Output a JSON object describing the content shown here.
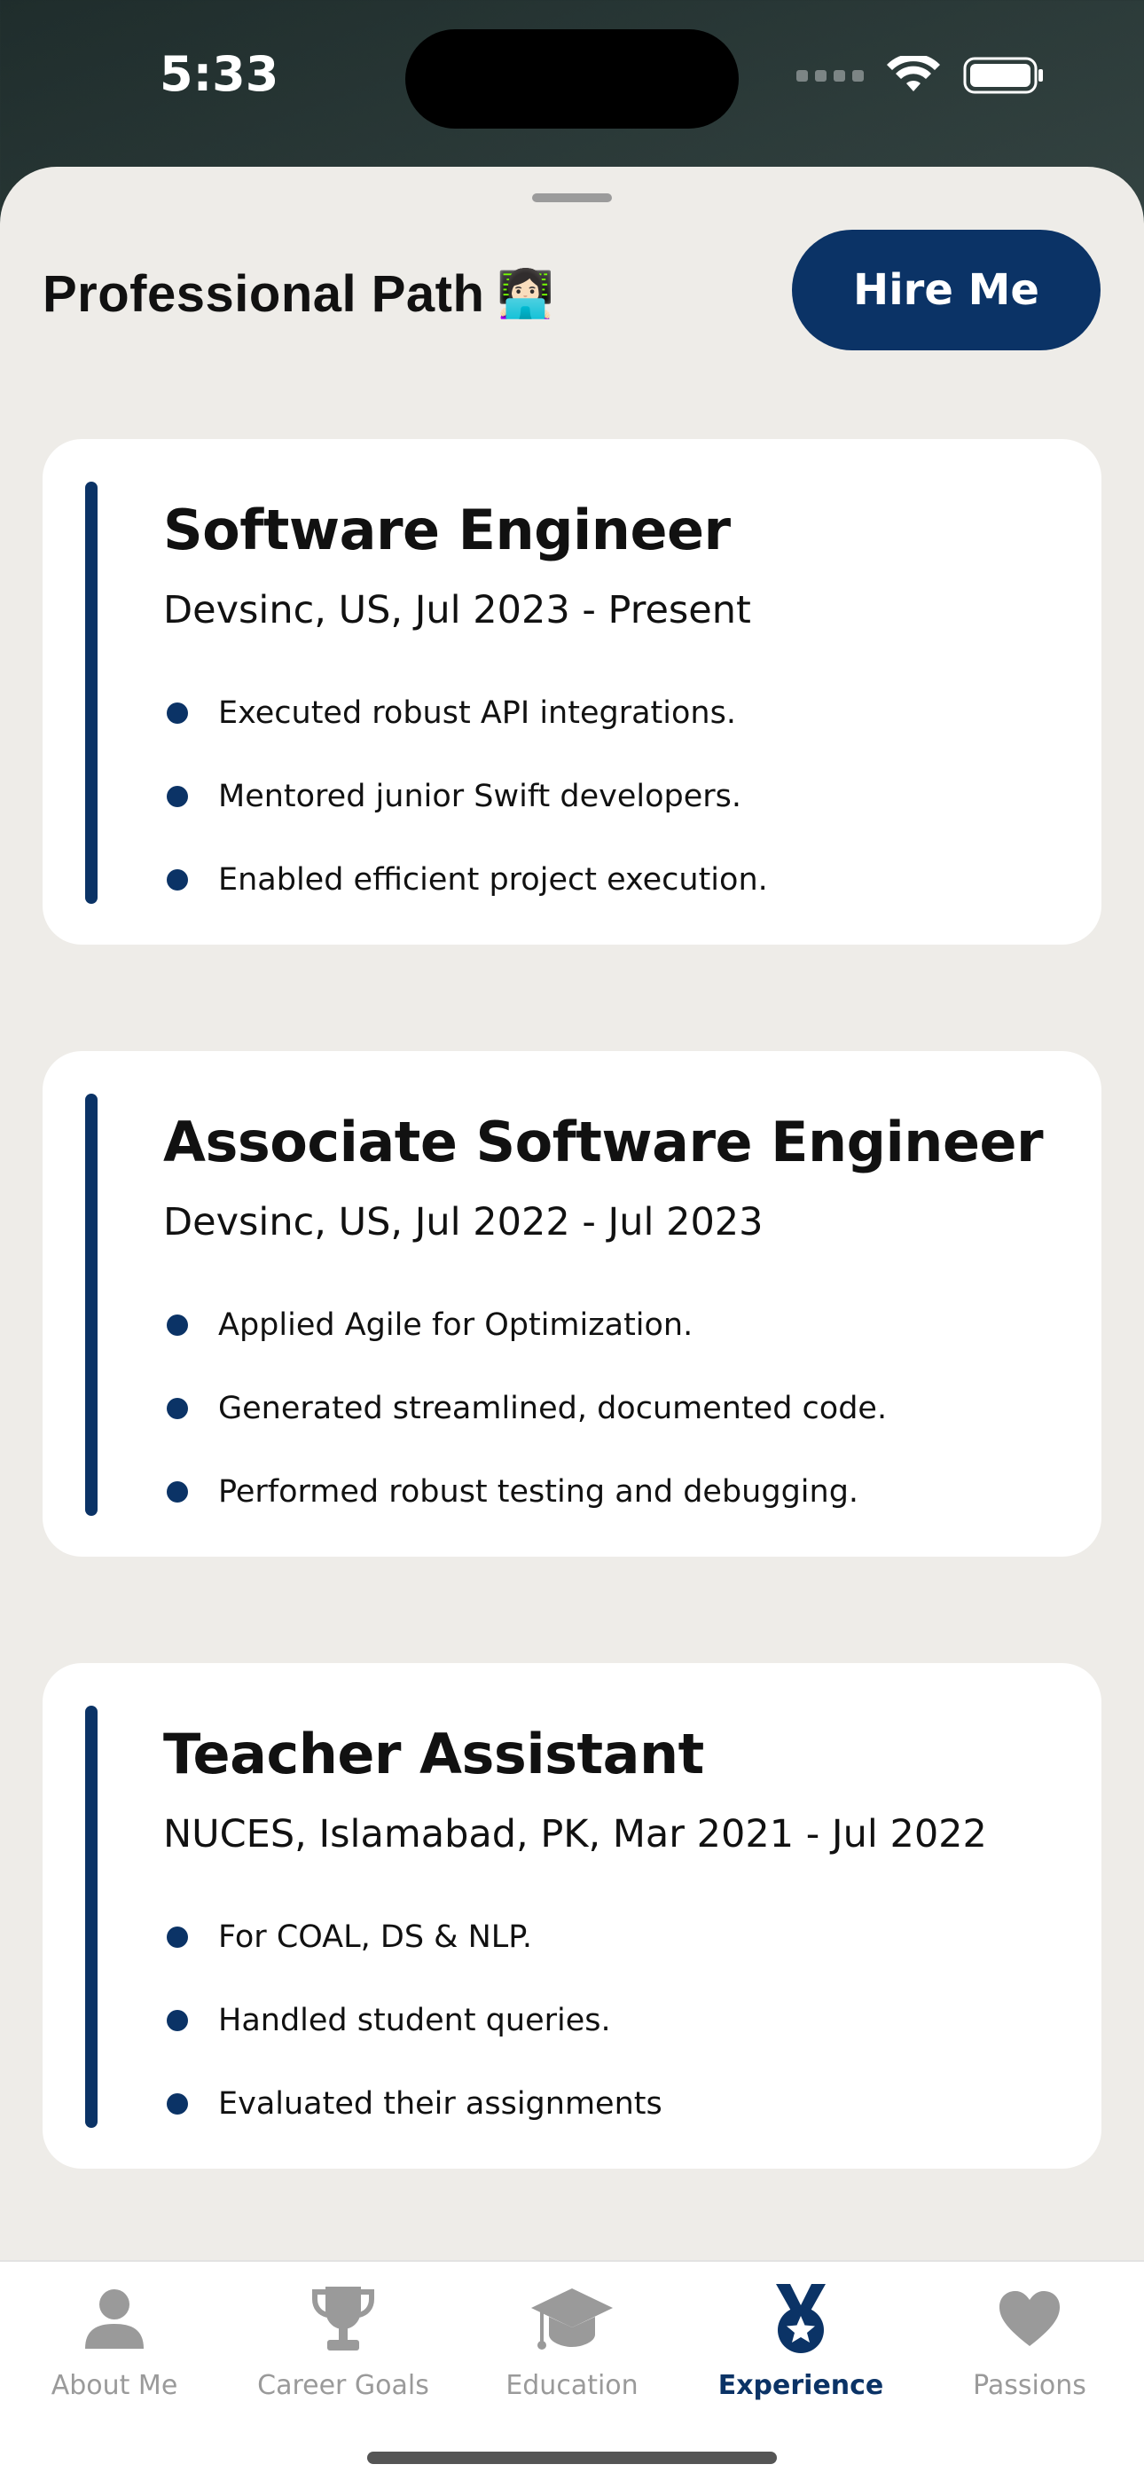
{
  "status": {
    "time": "5:33"
  },
  "header": {
    "title": "Professional Path",
    "emoji": "👩🏻‍💻",
    "hire_label": "Hire Me"
  },
  "experiences": [
    {
      "role": "Software Engineer",
      "meta": "Devsinc, US, Jul 2023 - Present",
      "points": [
        "Executed robust API integrations.",
        "Mentored junior Swift developers.",
        "Enabled efficient project execution."
      ]
    },
    {
      "role": "Associate Software Engineer",
      "meta": "Devsinc, US, Jul 2022 - Jul 2023",
      "points": [
        "Applied Agile for Optimization.",
        "Generated streamlined, documented code.",
        "Performed robust testing and debugging."
      ]
    },
    {
      "role": "Teacher Assistant",
      "meta": "NUCES, Islamabad, PK, Mar 2021 - Jul 2022",
      "points": [
        "For COAL, DS & NLP.",
        "Handled student queries.",
        "Evaluated their assignments"
      ]
    }
  ],
  "tabs": [
    {
      "label": "About Me",
      "icon": "person-icon"
    },
    {
      "label": "Career Goals",
      "icon": "trophy-icon"
    },
    {
      "label": "Education",
      "icon": "graduation-cap-icon"
    },
    {
      "label": "Experience",
      "icon": "medal-icon",
      "active": true
    },
    {
      "label": "Passions",
      "icon": "heart-icon"
    }
  ],
  "colors": {
    "accent": "#0b3366",
    "sheet_bg": "#eeece8",
    "inactive_tab": "#9a9a9a"
  }
}
